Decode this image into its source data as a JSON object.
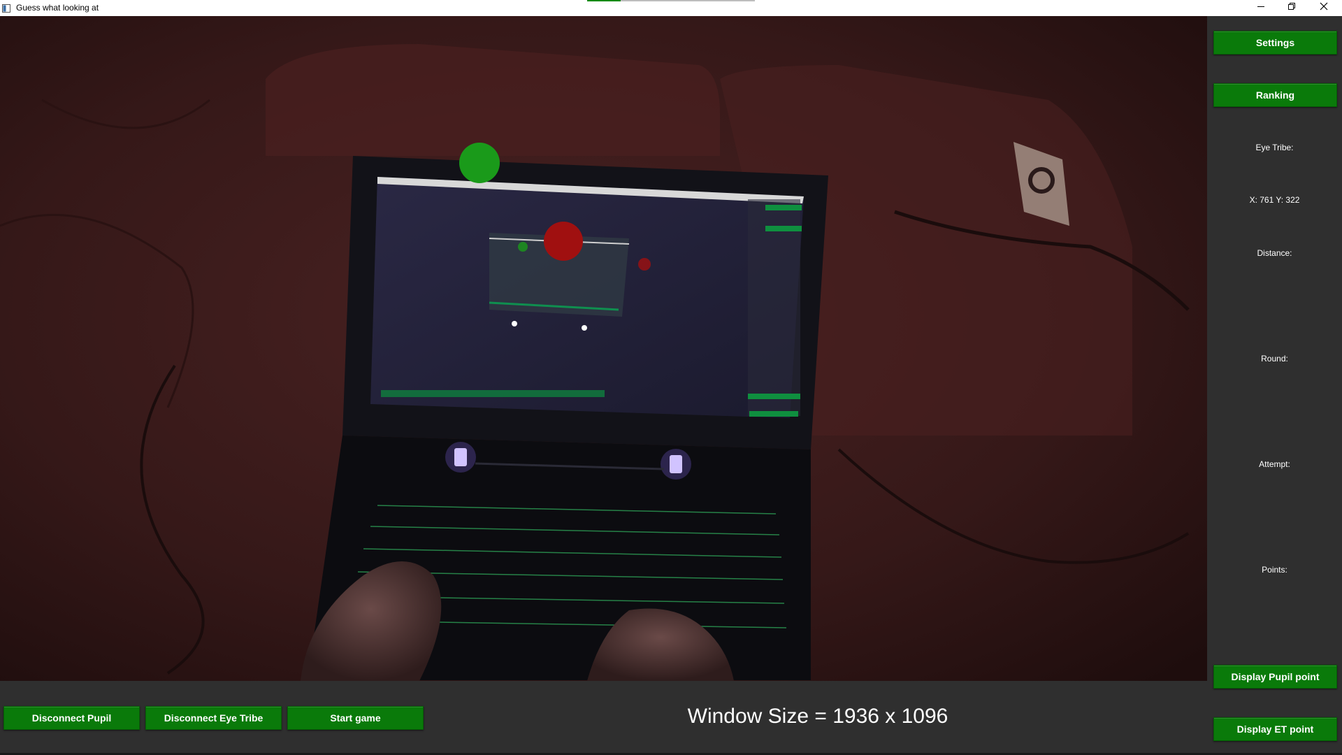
{
  "window": {
    "title": "Guess what looking at",
    "progress_fraction": 0.2
  },
  "panel": {
    "settings_label": "Settings",
    "ranking_label": "Ranking",
    "eye_tribe_label": "Eye Tribe:",
    "coords_label": "X: 761 Y: 322",
    "distance_label": "Distance:",
    "round_label": "Round:",
    "attempt_label": "Attempt:",
    "points_label": "Points:",
    "display_pupil_label": "Display Pupil point",
    "display_et_label": "Display ET point"
  },
  "bottom": {
    "disconnect_pupil_label": "Disconnect Pupil",
    "disconnect_eye_tribe_label": "Disconnect Eye Tribe",
    "start_game_label": "Start game",
    "window_size_text": "Window Size = 1936 x 1096"
  },
  "camera": {
    "gaze_markers": [
      {
        "name": "pupil-gaze-marker",
        "color": "#1a9a1a"
      },
      {
        "name": "eye-tribe-gaze-marker",
        "color": "#a01010"
      }
    ]
  },
  "colors": {
    "accent_green": "#0a7a0a",
    "panel_bg": "#2f2f2f"
  },
  "icons": [
    "app-icon",
    "minimize-icon",
    "maximize-icon",
    "close-icon"
  ]
}
